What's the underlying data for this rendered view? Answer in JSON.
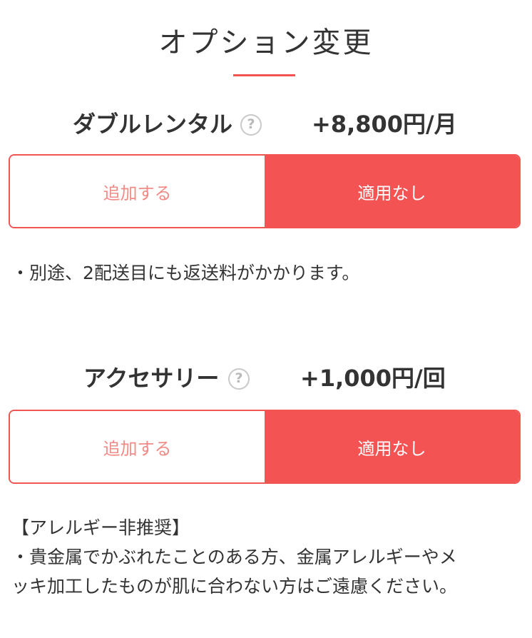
{
  "page": {
    "title": "オプション変更"
  },
  "colors": {
    "accent": "#f15451",
    "button_active_bg": "#f45354",
    "button_inactive_text": "#f08b86",
    "help_icon": "#c9c9c9",
    "text": "#333333"
  },
  "options": [
    {
      "name": "ダブルレンタル",
      "help_icon": "question-circle-icon",
      "help_glyph": "?",
      "price": "+8,800円/月",
      "add_label": "追加する",
      "none_label": "適用なし",
      "selected": "適用なし",
      "notes": [
        "・別途、2配送目にも返送料がかかります。"
      ]
    },
    {
      "name": "アクセサリー",
      "help_icon": "question-circle-icon",
      "help_glyph": "?",
      "price": "+1,000円/回",
      "add_label": "追加する",
      "none_label": "適用なし",
      "selected": "適用なし",
      "notes": [
        "【アレルギー非推奨】",
        "・貴金属でかぶれたことのある方、金属アレルギーやメ",
        "ッキ加工したものが肌に合わない方はご遠慮ください。"
      ]
    }
  ]
}
